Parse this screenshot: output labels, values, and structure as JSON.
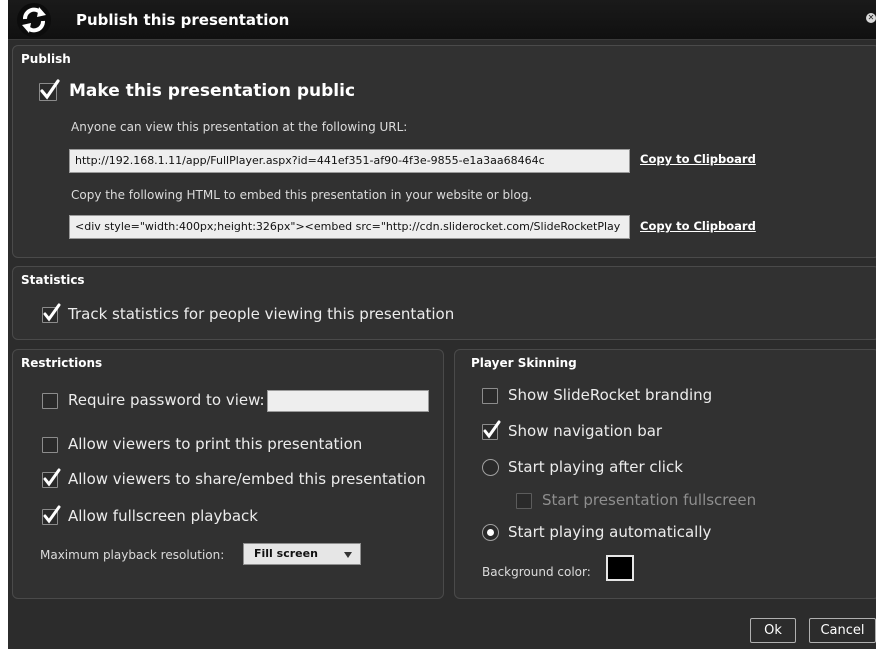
{
  "dialog": {
    "title": "Publish this presentation",
    "icons": {
      "logo": "sync-arrows-icon",
      "close": "close-icon"
    }
  },
  "publish": {
    "section_title": "Publish",
    "make_public_label": "Make this presentation public",
    "make_public_checked": true,
    "url_caption": "Anyone can view this presentation at the following URL:",
    "url_value": "http://192.168.1.11/app/FullPlayer.aspx?id=441ef351-af90-4f3e-9855-e1a3aa68464c",
    "embed_caption": "Copy the following HTML to embed this presentation in your website or blog.",
    "embed_value": "<div style=\"width:400px;height:326px\"><embed src=\"http://cdn.sliderocket.com/SlideRocketPlay",
    "copy_label": "Copy to Clipboard"
  },
  "statistics": {
    "section_title": "Statistics",
    "track_label": "Track statistics for people viewing this presentation",
    "track_checked": true
  },
  "restrictions": {
    "section_title": "Restrictions",
    "password_label": "Require password to view:",
    "password_checked": false,
    "password_value": "",
    "print_label": "Allow viewers to print this presentation",
    "print_checked": false,
    "share_label": "Allow viewers to share/embed this presentation",
    "share_checked": true,
    "fullscreen_label": "Allow fullscreen playback",
    "fullscreen_checked": true,
    "resolution_label": "Maximum playback resolution:",
    "resolution_value": "Fill screen"
  },
  "skinning": {
    "section_title": "Player Skinning",
    "branding_label": "Show SlideRocket branding",
    "branding_checked": false,
    "navbar_label": "Show navigation bar",
    "navbar_checked": true,
    "after_click_label": "Start playing after click",
    "after_click_selected": false,
    "fullscreen_start_label": "Start presentation fullscreen",
    "fullscreen_start_checked": false,
    "fullscreen_start_enabled": false,
    "auto_label": "Start playing automatically",
    "auto_selected": true,
    "bg_color_label": "Background color:",
    "bg_color": "#000000"
  },
  "footer": {
    "ok_label": "Ok",
    "cancel_label": "Cancel"
  }
}
